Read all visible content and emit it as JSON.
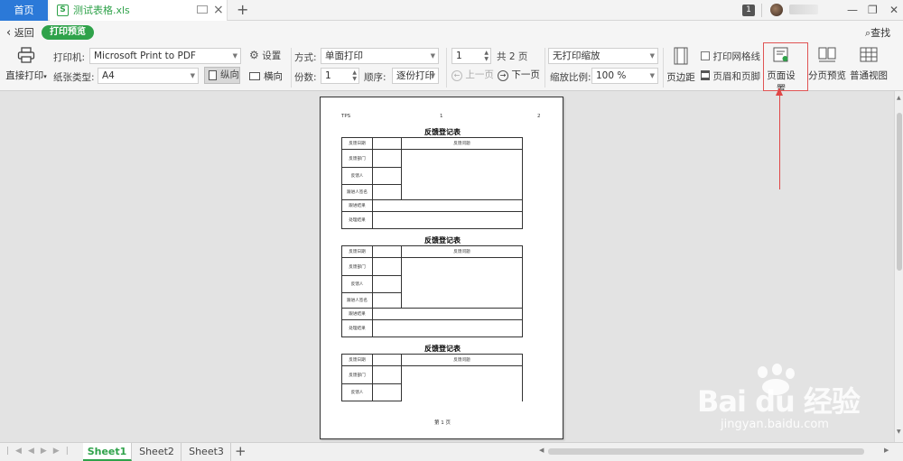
{
  "tabs": {
    "home": "首页",
    "document": "测试表格.xls"
  },
  "window": {
    "badge": "1"
  },
  "toolbar": {
    "back": "返回",
    "mode": "打印预览",
    "find": "查找"
  },
  "ribbon": {
    "direct_print": "直接打印",
    "printer_label": "打印机:",
    "printer_value": "Microsoft Print to PDF",
    "settings": "设置",
    "paper_label": "纸张类型:",
    "paper_value": "A4",
    "portrait": "纵向",
    "landscape": "横向",
    "method_label": "方式:",
    "method_value": "单面打印",
    "copies_label": "份数:",
    "copies_value": "1",
    "order_label": "顺序:",
    "order_value": "逐份打印",
    "page_value": "1",
    "total_pages": "共 2 页",
    "prev_page": "上一页",
    "next_page": "下一页",
    "scaling_value": "无打印缩放",
    "zoom_label": "缩放比例:",
    "zoom_value": "100 %",
    "margins": "页边距",
    "print_gridlines": "打印网格线",
    "header_footer": "页眉和页脚",
    "page_setup": "页面设置",
    "page_break_preview": "分页预览",
    "normal_view": "普通视图"
  },
  "preview": {
    "header_left": "TPS",
    "header_mid": "1",
    "header_right": "2",
    "form_title": "反馈登记表",
    "row_date": "反馈日期",
    "row_issue": "反馈问题",
    "row_dept": "反馈部门",
    "row_person": "反馈人",
    "row_tracker": "跟进人签名",
    "row_result": "跟进结果",
    "row_handle": "处理结果",
    "footer": "第 1 页"
  },
  "sheets": [
    "Sheet1",
    "Sheet2",
    "Sheet3"
  ],
  "watermark": {
    "brand": "Bai du 经验",
    "url": "jingyan.baidu.com"
  },
  "colors": {
    "accent_green": "#2fa24a",
    "home_tab_blue": "#2b79d8",
    "annotation_red": "#e04646"
  }
}
